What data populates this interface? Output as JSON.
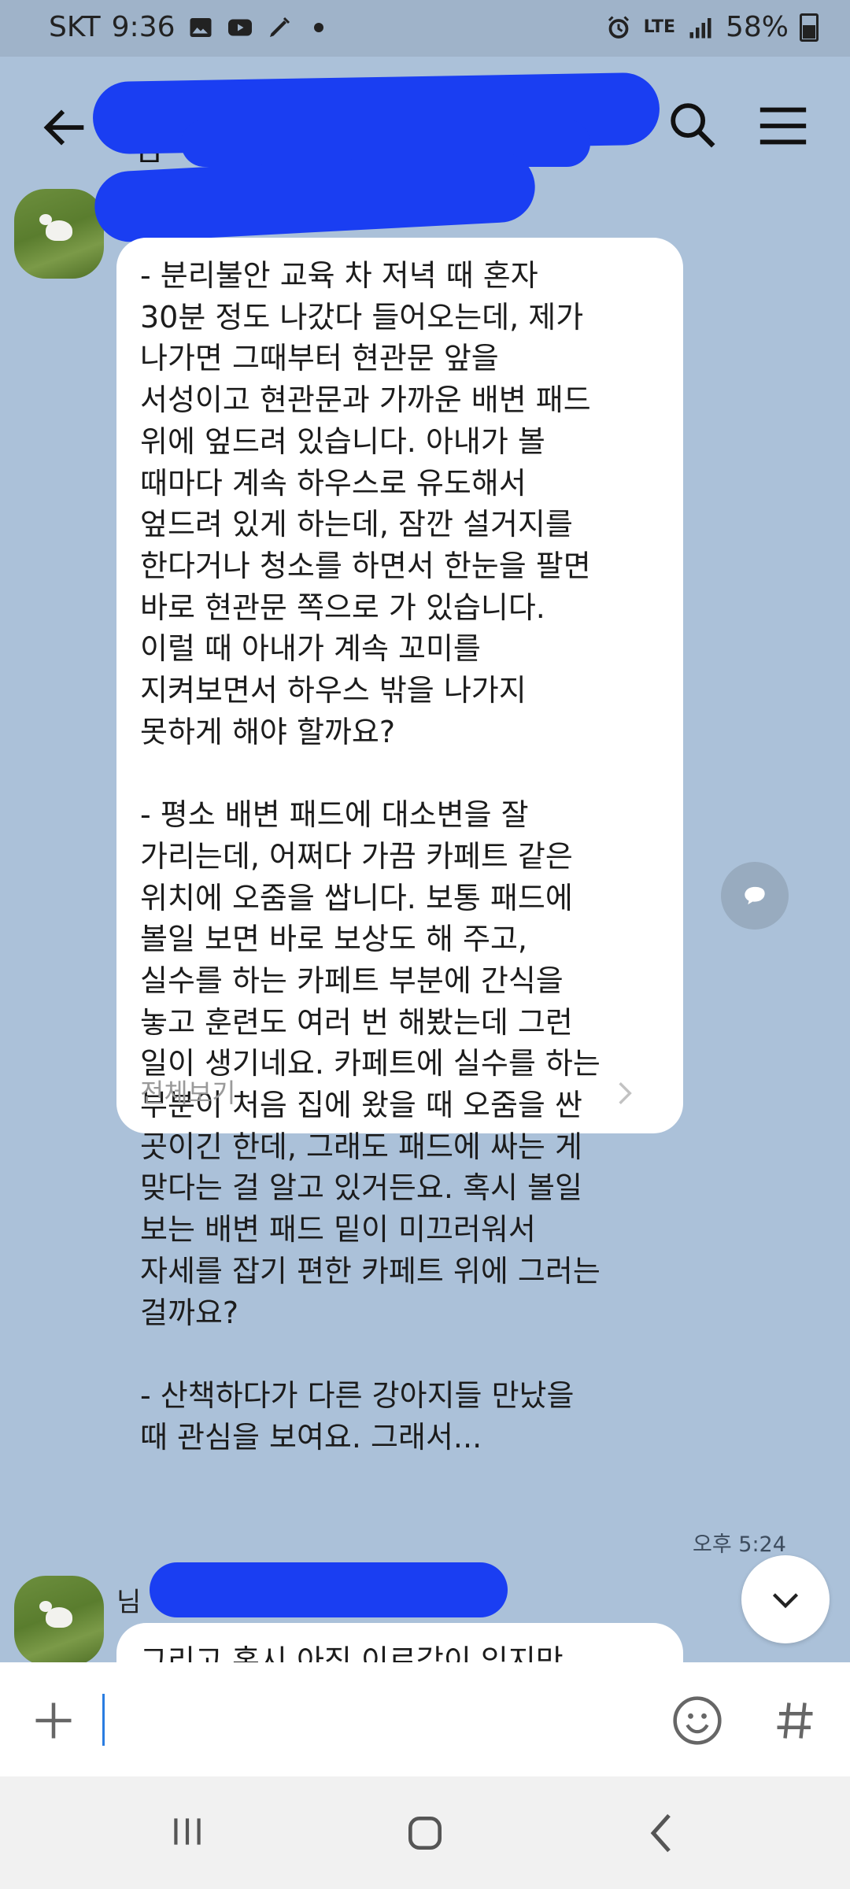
{
  "status_bar": {
    "carrier": "SKT",
    "time": "9:36",
    "network": "LTE",
    "battery": "58%",
    "left_icons": [
      "gallery-icon",
      "youtube-icon",
      "pen-icon",
      "dot-icon"
    ],
    "right_icons": [
      "alarm-icon",
      "lte-icon",
      "signal-icon",
      "battery-icon"
    ]
  },
  "header": {
    "title": "님"
  },
  "messages": [
    {
      "sender": "",
      "text": "- 분리불안 교육 차 저녁 때 혼자\n30분 정도 나갔다 들어오는데, 제가\n나가면 그때부터 현관문 앞을\n서성이고 현관문과 가까운 배변 패드\n위에 엎드려 있습니다. 아내가 볼\n때마다 계속 하우스로 유도해서\n엎드려 있게 하는데, 잠깐 설거지를\n한다거나 청소를 하면서 한눈을 팔면\n바로 현관문 쪽으로 가 있습니다.\n이럴 때 아내가 계속 꼬미를\n지켜보면서 하우스 밖을 나가지\n못하게 해야 할까요?\n\n- 평소 배변 패드에 대소변을 잘\n가리는데, 어쩌다 가끔 카페트 같은\n위치에 오줌을 쌉니다. 보통 패드에\n볼일 보면 바로 보상도 해 주고,\n실수를 하는 카페트 부분에 간식을\n놓고 훈련도 여러 번 해봤는데 그런\n일이 생기네요. 카페트에 실수를 하는\n부분이 처음 집에 왔을 때 오줌을 싼\n곳이긴 한데, 그래도 패드에 싸는 게\n맞다는 걸 알고 있거든요. 혹시 볼일\n보는 배변 패드 밑이 미끄러워서\n자세를 잡기 편한 카페트 위에 그러는\n걸까요?\n\n- 산책하다가 다른 강아지들 만났을\n때 관심을 보여요. 그래서...",
      "more_label": "전체보기",
      "time": "오후 5:24"
    },
    {
      "sender": "님",
      "text": "그리고 혹시 아직 이르감이 있지만"
    }
  ],
  "input": {
    "placeholder": ""
  },
  "colors": {
    "chat_background": "#abc1d9",
    "bubble": "#ffffff",
    "redaction": "#1a3ef2",
    "cursor": "#2a7de1"
  }
}
